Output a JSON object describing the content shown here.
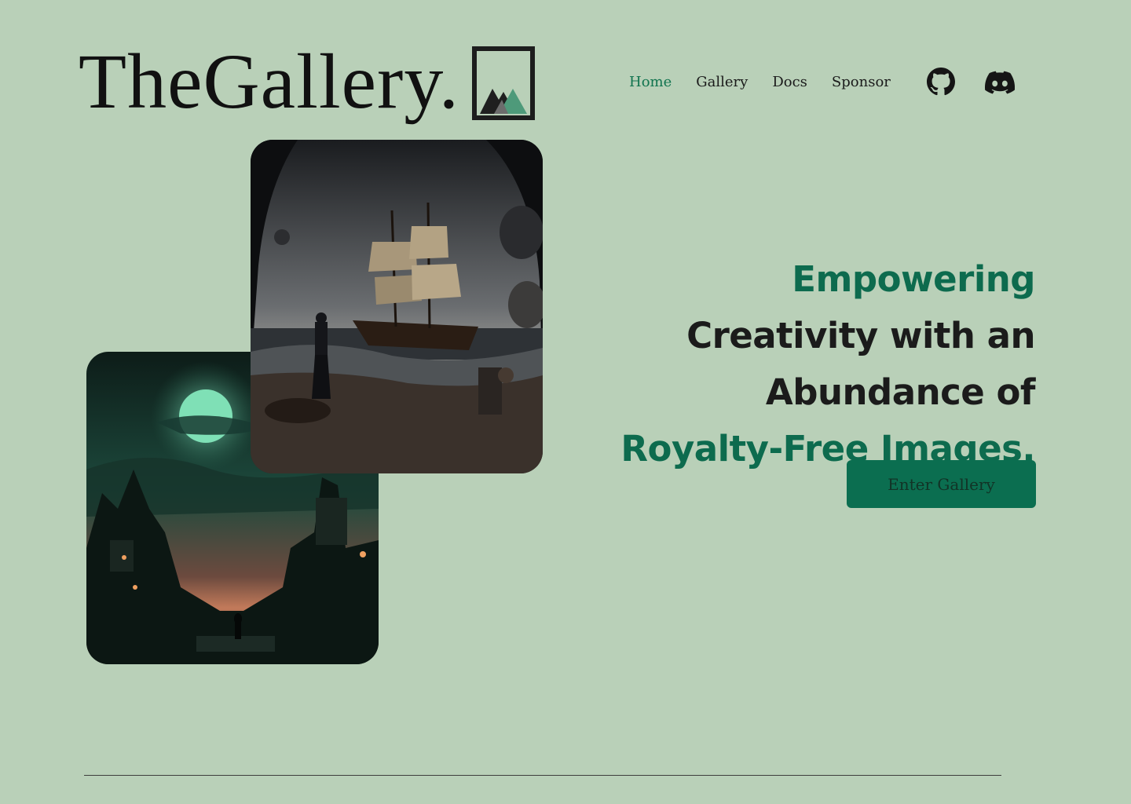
{
  "brand": {
    "name": "TheGallery.",
    "logo_icon": "framed-mountain-icon"
  },
  "nav": {
    "items": [
      {
        "label": "Home",
        "active": true
      },
      {
        "label": "Gallery",
        "active": false
      },
      {
        "label": "Docs",
        "active": false
      },
      {
        "label": "Sponsor",
        "active": false
      }
    ],
    "social": [
      {
        "icon": "github-icon"
      },
      {
        "icon": "discord-icon"
      }
    ]
  },
  "hero": {
    "headline": {
      "part1": "Empowering",
      "part2": " Creativity with an Abundance of ",
      "part3": "Royalty-Free Images."
    },
    "cta_label": "Enter Gallery",
    "images": [
      {
        "subject": "moonlit-fantasy-town"
      },
      {
        "subject": "woman-with-ship-storm"
      }
    ]
  },
  "colors": {
    "background": "#b9d0b8",
    "accent": "#0d6b4e",
    "text": "#1b1b1b"
  }
}
